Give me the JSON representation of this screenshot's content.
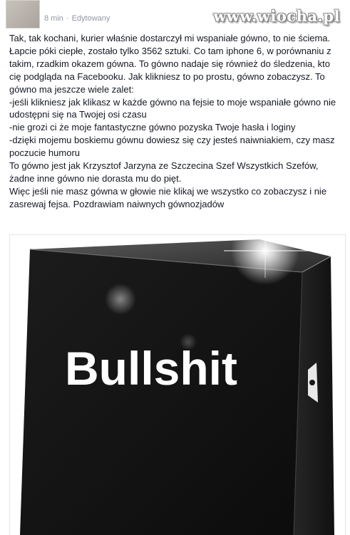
{
  "post": {
    "meta_time": "8 min",
    "meta_separator": "·",
    "meta_status": "Edytowany",
    "paragraphs": [
      "Tak, tak kochani, kurier właśnie dostarczył mi wspaniałe gówno, to nie ściema. Łapcie póki ciepłe, zostało tylko 3562 sztuki. Co tam iphone 6, w porównaniu z takim, rzadkim okazem gówna. To gówno nadaje się również do śledzenia, kto cię podgląda na Facebooku. Jak klikniesz to po prostu, gówno zobaczysz. To gówno ma jeszcze wiele zalet:",
      "-jeśli klikniesz jak klikasz w każde gówno na fejsie to moje wspaniałe gówno nie udostępni się na Twojej osi czasu",
      "-nie grozi ci że moje fantastyczne gówno pozyska Twoje hasła i loginy",
      "-dzięki mojemu boskiemu gównu dowiesz się czy jesteś naiwniakiem, czy masz poczucie humoru",
      "To gówno jest jak Krzysztof Jarzyna ze Szczecina Szef Wszystkich Szefów, żadne inne gówno nie dorasta mu do pięt.",
      "Więc jeśli nie masz gówna w głowie nie klikaj we wszystko co zobaczysz i nie zasrewaj fejsa. Pozdrawiam naiwnych gównozjadów"
    ],
    "image_label": "Bullshit"
  },
  "watermark": "www.wiocha.pl"
}
